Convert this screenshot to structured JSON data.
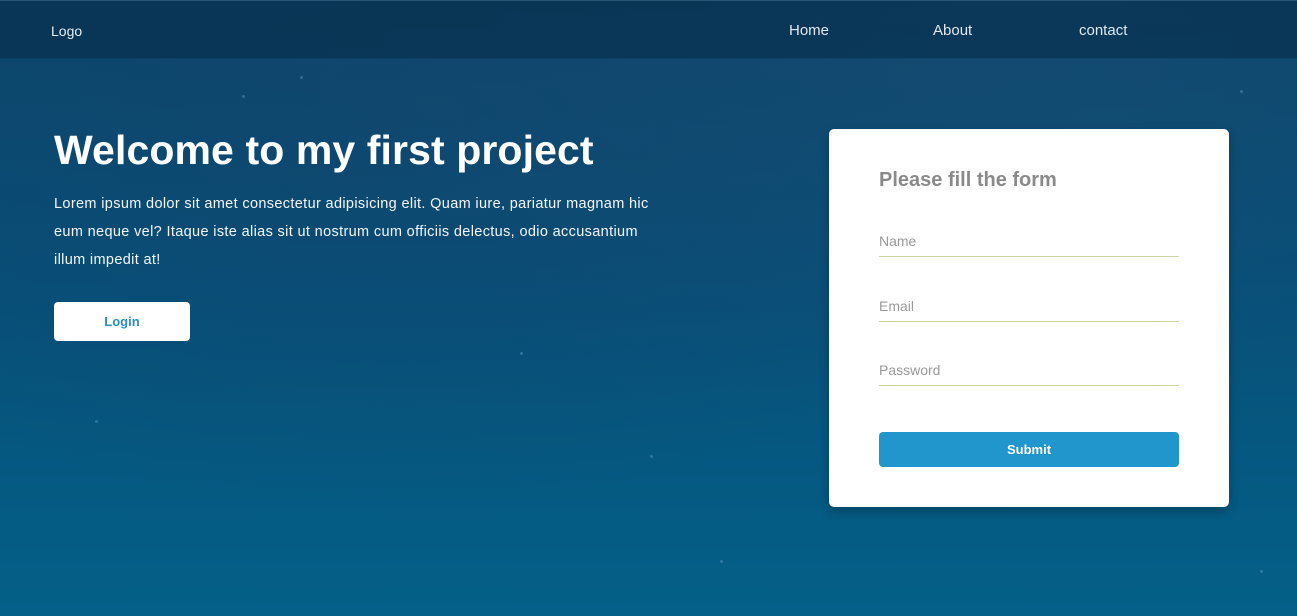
{
  "nav": {
    "logo": "Logo",
    "links": [
      "Home",
      "About",
      "contact"
    ]
  },
  "hero": {
    "title": "Welcome to my first project",
    "text": "Lorem ipsum dolor sit amet consectetur adipisicing elit. Quam iure, pariatur magnam hic eum neque vel? Itaque iste alias sit ut nostrum cum officiis delectus, odio accusantium illum impedit at!",
    "login_label": "Login"
  },
  "form": {
    "title": "Please fill the form",
    "name_placeholder": "Name",
    "email_placeholder": "Email",
    "password_placeholder": "Password",
    "submit_label": "Submit"
  },
  "colors": {
    "background": "#054a72",
    "accent": "#2196cc",
    "card": "#ffffff"
  }
}
